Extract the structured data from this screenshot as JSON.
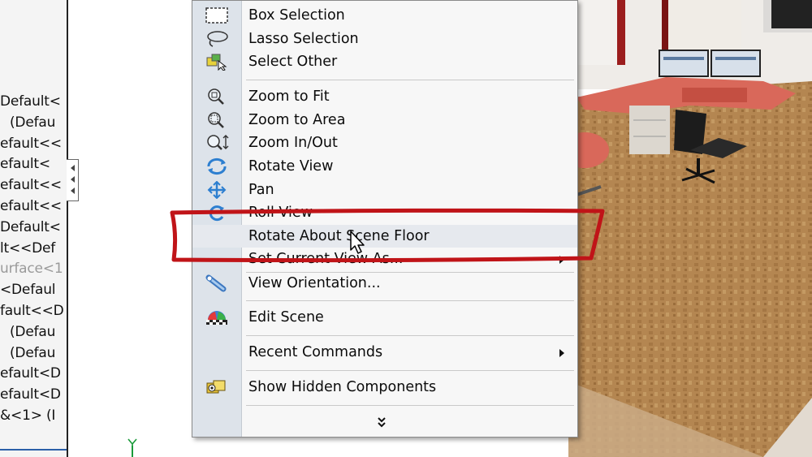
{
  "tree": {
    "rows": [
      "Default<",
      "(Defau",
      "efault<<",
      "efault<",
      "efault<<",
      "efault<<",
      "Default<",
      "lt<<Def",
      "urface<1",
      "<Defaul",
      "fault<<D",
      "(Defau",
      "(Defau",
      "efault<D",
      "efault<D",
      "&<1> (I"
    ]
  },
  "menu": {
    "items": [
      {
        "label": "Box Selection",
        "icon": "box-selection-icon"
      },
      {
        "label": "Lasso Selection",
        "icon": "lasso-icon"
      },
      {
        "label": "Select Other",
        "icon": "select-other-icon"
      },
      {
        "label": "Zoom to Fit",
        "icon": "zoom-fit-icon"
      },
      {
        "label": "Zoom to Area",
        "icon": "zoom-area-icon"
      },
      {
        "label": "Zoom In/Out",
        "icon": "zoom-in-out-icon"
      },
      {
        "label": "Rotate View",
        "icon": "rotate-view-icon"
      },
      {
        "label": "Pan",
        "icon": "pan-icon"
      },
      {
        "label": "Roll View",
        "icon": "roll-view-icon"
      },
      {
        "label": "Rotate About Scene Floor",
        "icon": ""
      },
      {
        "label": "Set Current View As...",
        "icon": ""
      },
      {
        "label": "View Orientation...",
        "icon": "view-orientation-icon"
      },
      {
        "label": "Edit Scene",
        "icon": "edit-scene-icon"
      },
      {
        "label": "Recent Commands",
        "icon": ""
      },
      {
        "label": "Show Hidden Components",
        "icon": "show-hidden-icon"
      }
    ],
    "more_icon": "double-chevron-down-icon"
  },
  "colors": {
    "annotation": "#c01418",
    "menu_gutter": "#dde3ea",
    "floor": "#b78a55",
    "desk": "#d7695a"
  }
}
